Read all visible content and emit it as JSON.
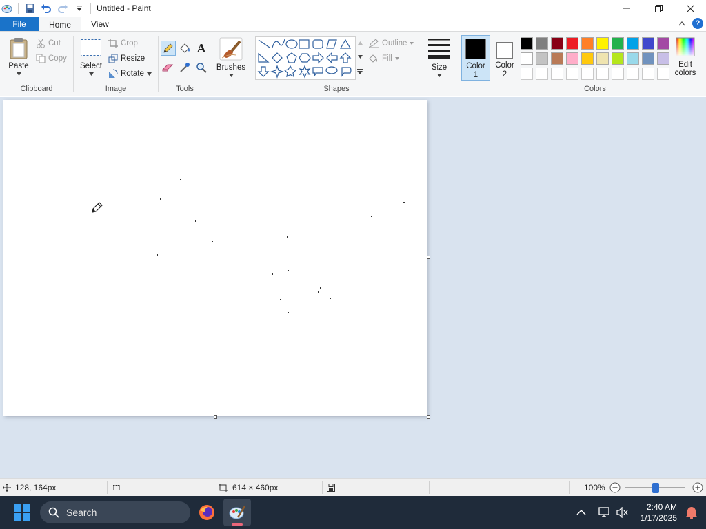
{
  "window": {
    "title": "Untitled - Paint",
    "controls": [
      "minimize",
      "restore",
      "close"
    ]
  },
  "tabs": {
    "file": "File",
    "home": "Home",
    "view": "View",
    "active": "Home"
  },
  "ribbon": {
    "clipboard": {
      "label": "Clipboard",
      "paste": "Paste",
      "cut": "Cut",
      "copy": "Copy"
    },
    "image": {
      "label": "Image",
      "select": "Select",
      "crop": "Crop",
      "resize": "Resize",
      "rotate": "Rotate"
    },
    "tools": {
      "label": "Tools",
      "items": [
        "pencil-icon",
        "fill-icon",
        "text-icon",
        "eraser-icon",
        "color-picker-icon",
        "magnifier-icon"
      ],
      "selected": "pencil-icon"
    },
    "brushes": {
      "label": "Brushes"
    },
    "shapes": {
      "label": "Shapes",
      "outline": "Outline",
      "fill": "Fill"
    },
    "size": {
      "label": "Size"
    },
    "color1": {
      "label_line1": "Color",
      "label_line2": "1",
      "color": "#000000"
    },
    "color2": {
      "label_line1": "Color",
      "label_line2": "2",
      "color": "#ffffff"
    },
    "colors": {
      "label": "Colors",
      "row1": [
        "#000000",
        "#7f7f7f",
        "#880015",
        "#ed1c24",
        "#ff7f27",
        "#fff200",
        "#22b14c",
        "#00a2e8",
        "#3f48cc",
        "#a349a4"
      ],
      "row2": [
        "#ffffff",
        "#c3c3c3",
        "#b97a57",
        "#ffaec9",
        "#ffc90e",
        "#efe4b0",
        "#b5e61d",
        "#99d9ea",
        "#7092be",
        "#c8bfe7"
      ],
      "edit_line1": "Edit",
      "edit_line2": "colors"
    }
  },
  "status": {
    "cursor_pos": "128, 164px",
    "canvas_size": "614 × 460px",
    "zoom": "100%"
  },
  "taskbar": {
    "search": "Search",
    "time": "2:40 AM",
    "date": "1/17/2025"
  },
  "accent": "#1a73c9"
}
